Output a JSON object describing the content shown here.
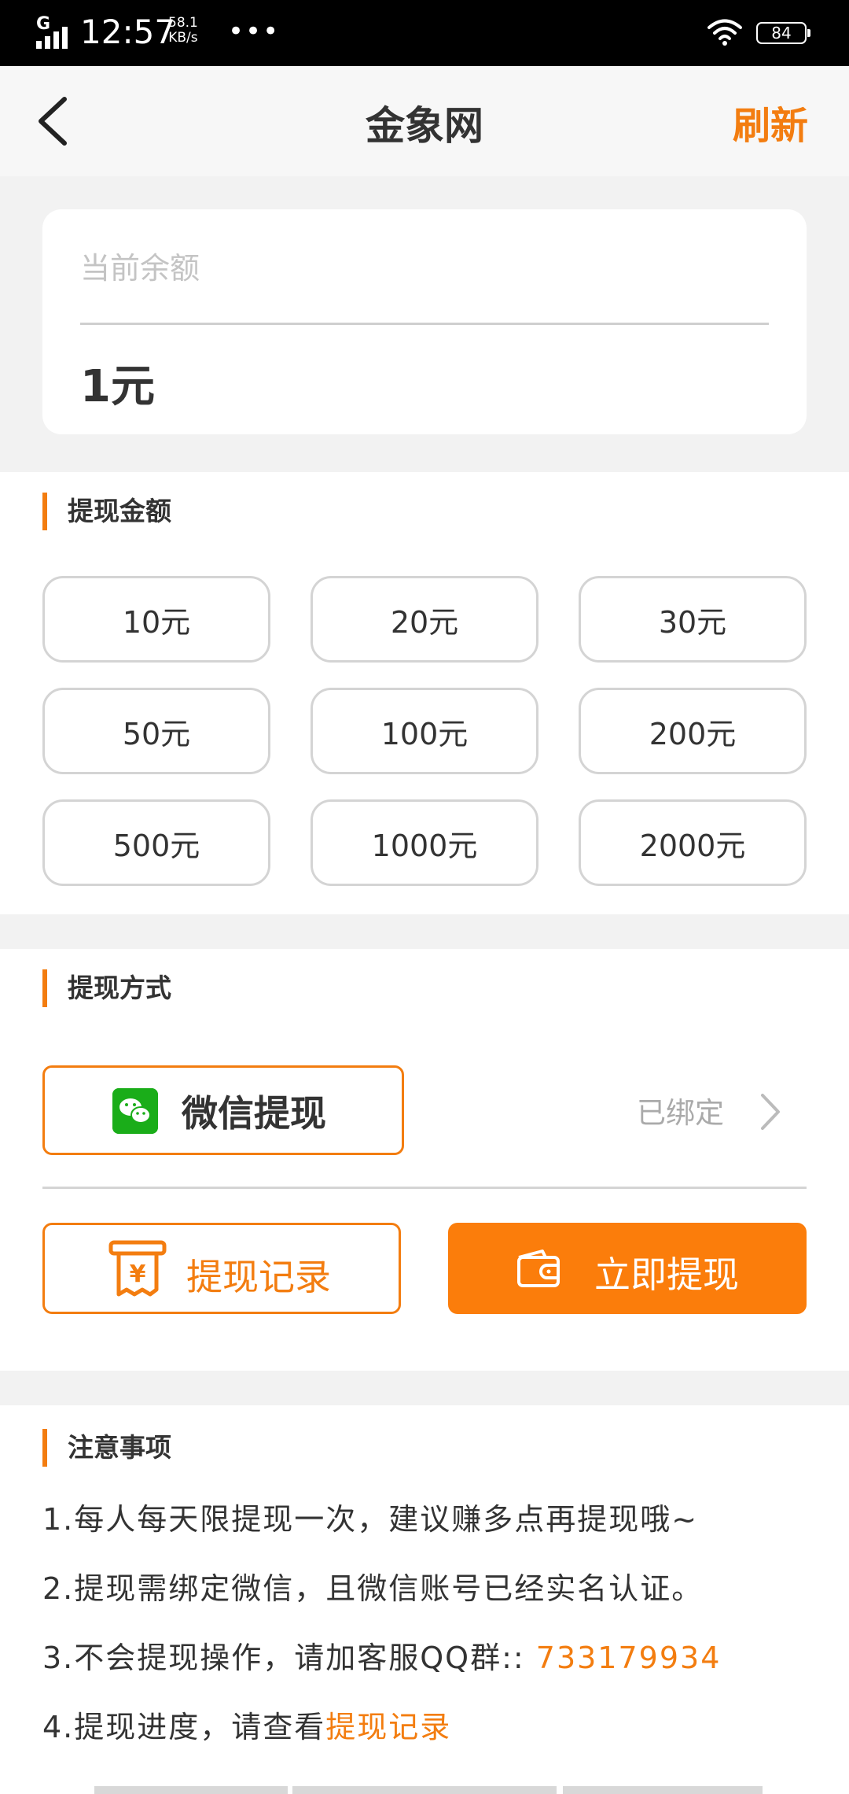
{
  "status_bar": {
    "network": "G",
    "time": "12:57",
    "speed_value": "58.1",
    "speed_unit": "KB/s",
    "more": "•••",
    "battery": "84"
  },
  "header": {
    "title": "金象网",
    "refresh_label": "刷新"
  },
  "balance": {
    "label": "当前余额",
    "value": "1元"
  },
  "amount_section": {
    "title": "提现金额",
    "options": [
      "10元",
      "20元",
      "30元",
      "50元",
      "100元",
      "200元",
      "500元",
      "1000元",
      "2000元"
    ]
  },
  "method_section": {
    "title": "提现方式",
    "wechat_label": "微信提现",
    "bound_status": "已绑定",
    "record_label": "提现记录",
    "withdraw_label": "立即提现"
  },
  "notes_section": {
    "title": "注意事项",
    "note1": "1.每人每天限提现一次，建议赚多点再提现哦~",
    "note2": "2.提现需绑定微信，且微信账号已经实名认证。",
    "note3_prefix": "3.不会提现操作，请加客服QQ群::",
    "note3_qq": "733179934",
    "note4_prefix": "4.提现进度，请查看",
    "note4_link": "提现记录"
  },
  "colors": {
    "accent": "#f37d10",
    "wechat_green": "#1aad19"
  },
  "icons": [
    "back-arrow-icon",
    "wifi-icon",
    "signal-icon",
    "wechat-icon",
    "chevron-right-icon",
    "receipt-yen-icon",
    "wallet-icon"
  ]
}
